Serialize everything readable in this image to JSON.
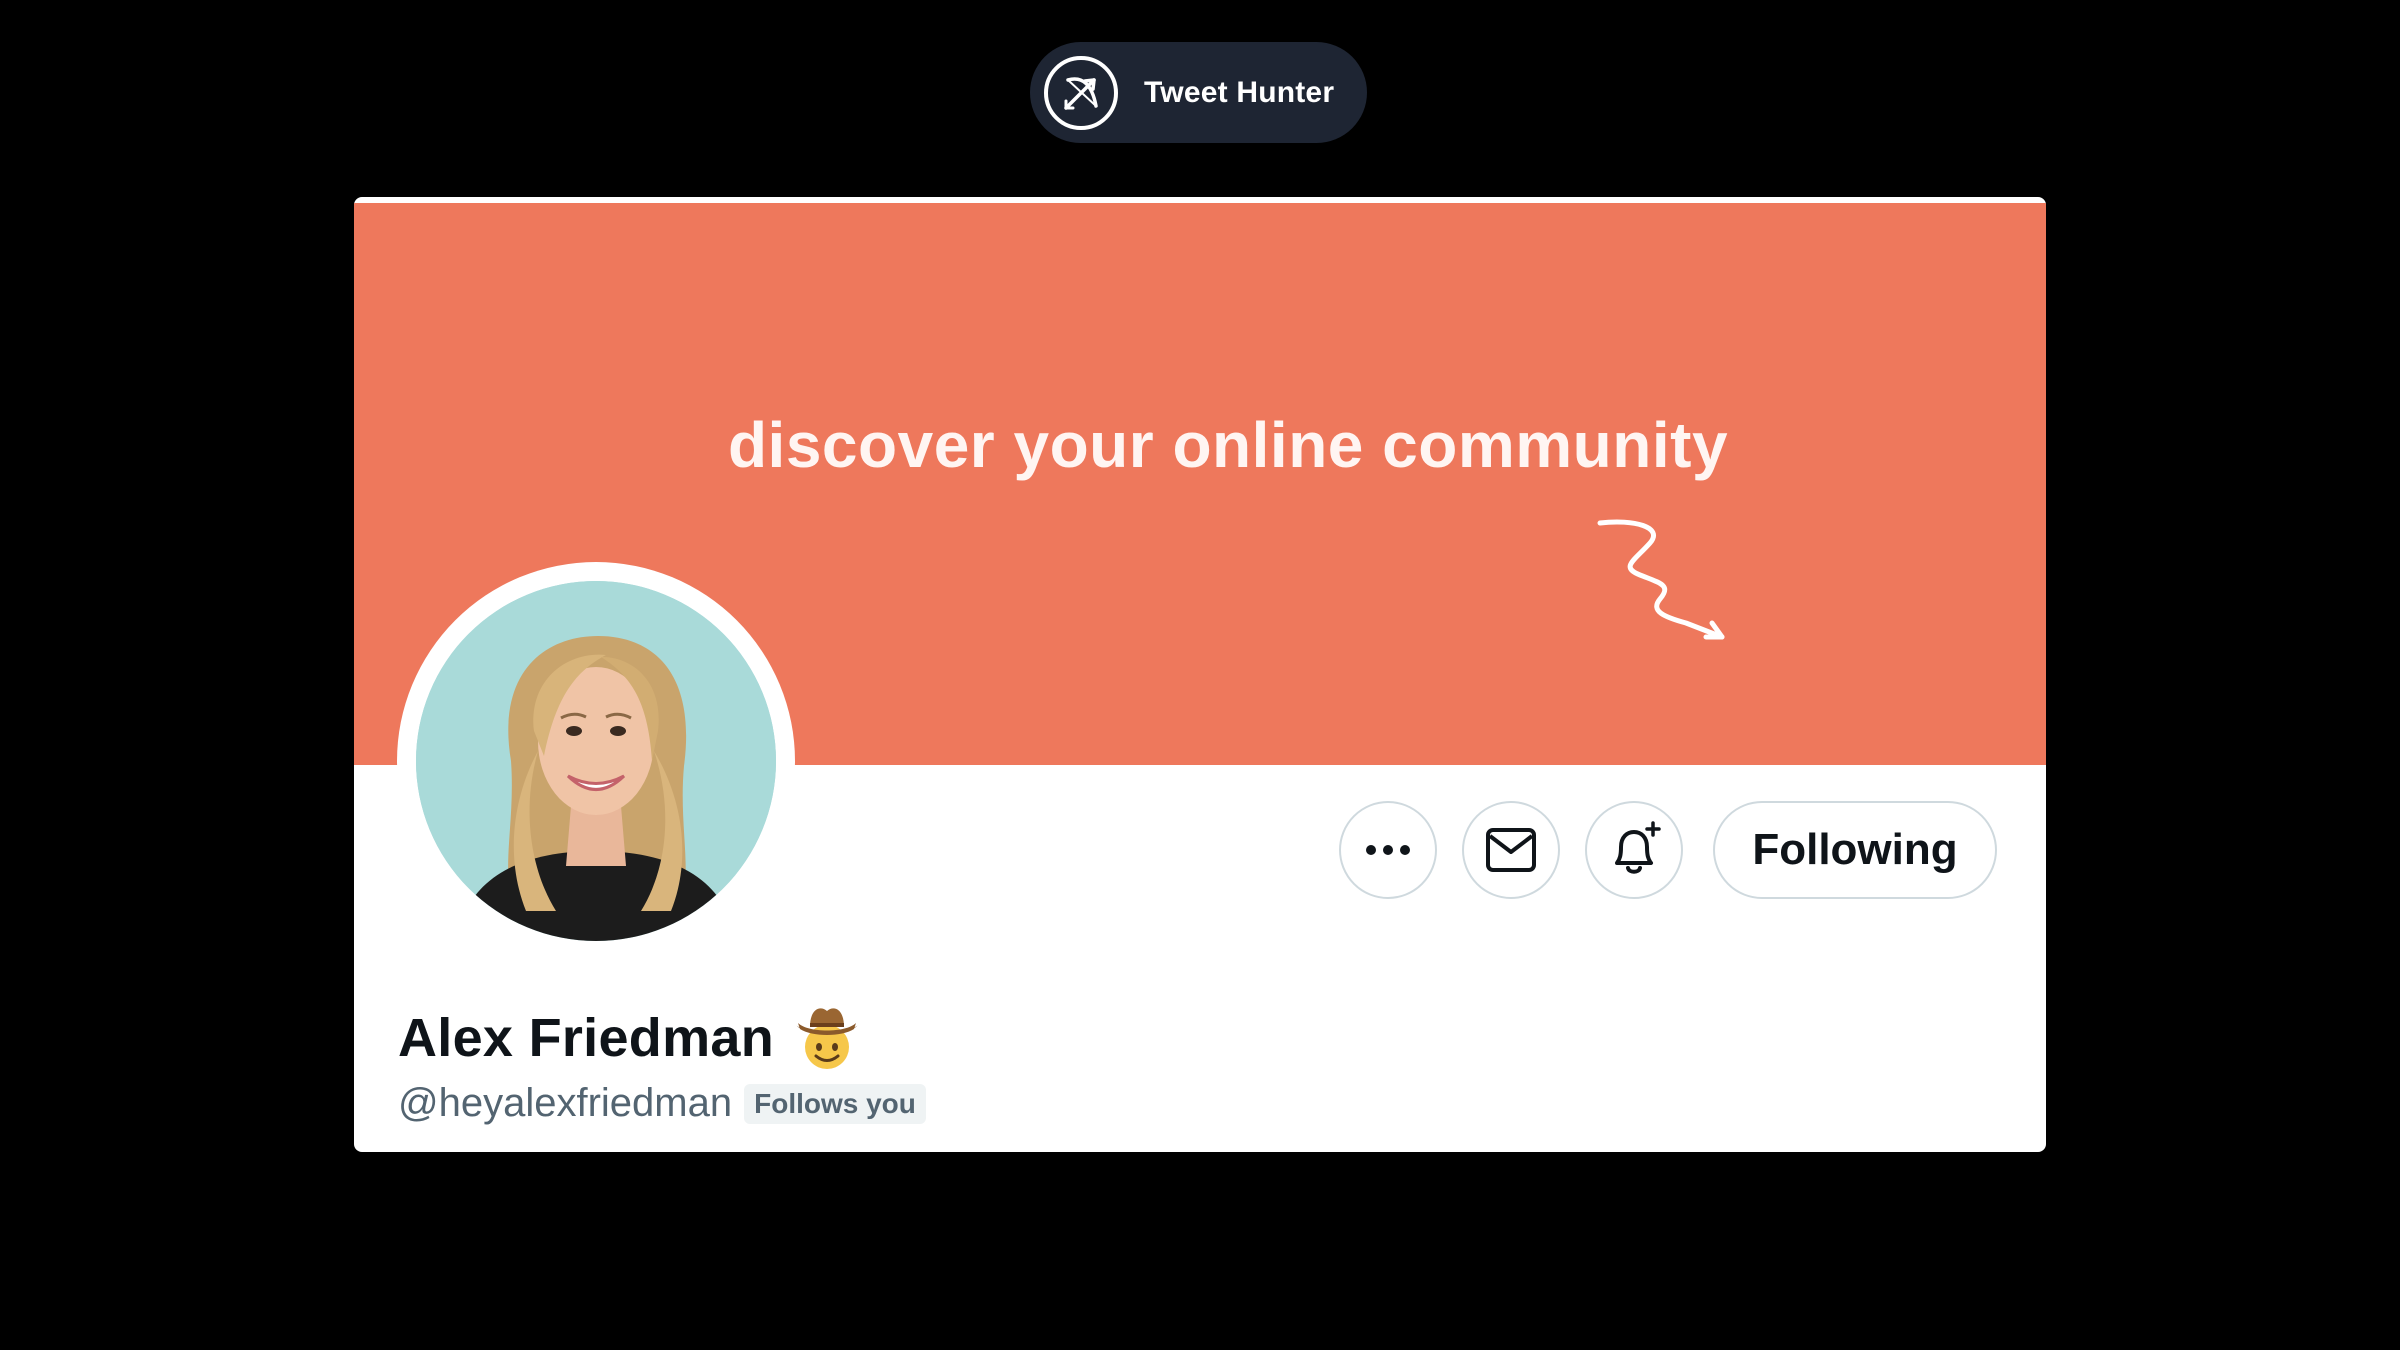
{
  "brand": {
    "name": "Tweet Hunter",
    "logo_icon": "bow-arrow-icon"
  },
  "profile": {
    "banner_text": "discover your online community",
    "banner_color": "#ee785c",
    "display_name": "Alex Friedman",
    "name_emoji": "cowboy-hat-face-emoji",
    "handle": "@heyalexfriedman",
    "follows_badge": "Follows you"
  },
  "actions": {
    "more_icon": "more-dots-icon",
    "message_icon": "envelope-icon",
    "notify_icon": "bell-plus-icon",
    "following_label": "Following"
  }
}
